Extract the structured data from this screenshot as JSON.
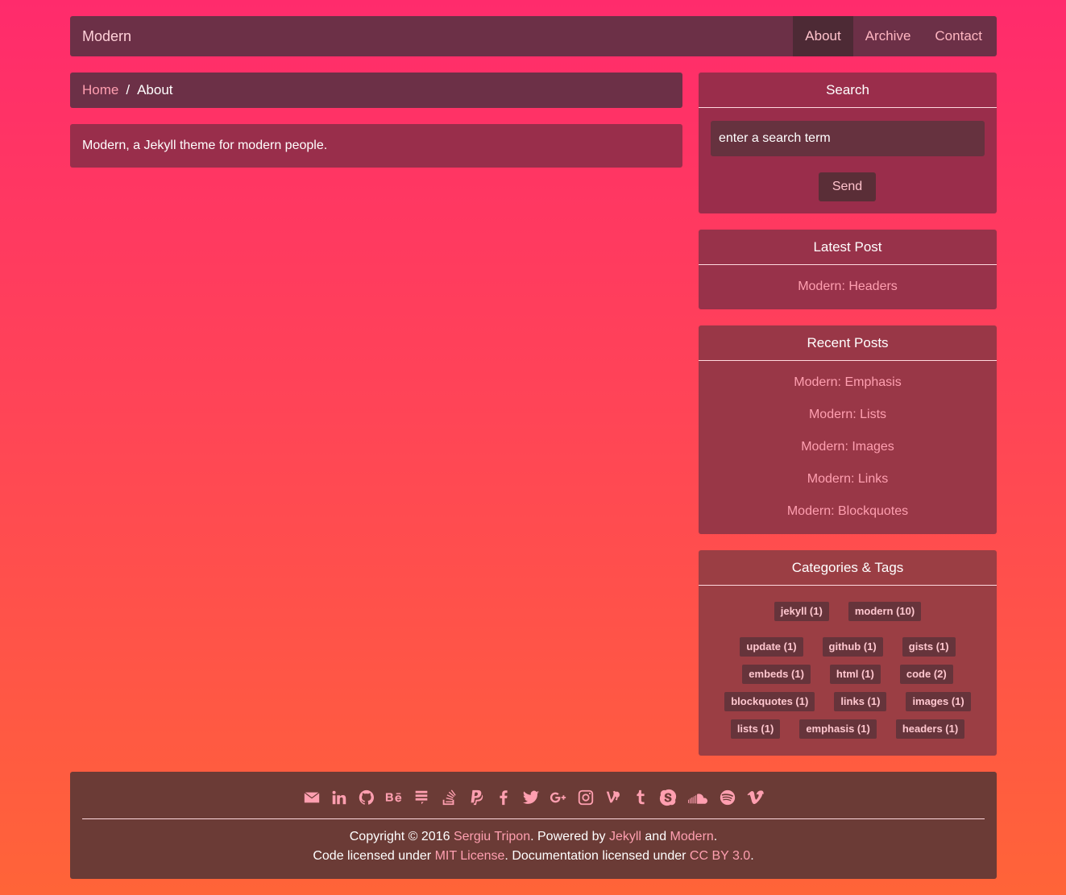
{
  "nav": {
    "brand": "Modern",
    "items": [
      {
        "label": "About",
        "active": true
      },
      {
        "label": "Archive"
      },
      {
        "label": "Contact"
      }
    ]
  },
  "breadcrumb": {
    "home": "Home",
    "separator": "/",
    "current": "About"
  },
  "content": {
    "text": "Modern, a Jekyll theme for modern people."
  },
  "search": {
    "title": "Search",
    "placeholder": "enter a search term",
    "button": "Send"
  },
  "latest": {
    "title": "Latest Post",
    "post": "Modern: Headers"
  },
  "recent": {
    "title": "Recent Posts",
    "posts": [
      "Modern: Emphasis",
      "Modern: Lists",
      "Modern: Images",
      "Modern: Links",
      "Modern: Blockquotes"
    ]
  },
  "tags": {
    "title": "Categories & Tags",
    "categories": [
      "jekyll (1)",
      "modern (10)"
    ],
    "tag_rows": [
      [
        "update (1)",
        "github (1)",
        "gists (1)"
      ],
      [
        "embeds (1)",
        "html (1)",
        "code (2)"
      ],
      [
        "blockquotes (1)",
        "links (1)",
        "images (1)"
      ],
      [
        "lists (1)",
        "emphasis (1)",
        "headers (1)"
      ]
    ]
  },
  "footer": {
    "social_icons": [
      "envelope-icon",
      "linkedin-icon",
      "github-icon",
      "behance-icon",
      "stack-exchange-icon",
      "stack-overflow-icon",
      "paypal-icon",
      "facebook-icon",
      "twitter-icon",
      "google-plus-icon",
      "instagram-icon",
      "vine-icon",
      "tumblr-icon",
      "skype-icon",
      "soundcloud-icon",
      "spotify-icon",
      "vimeo-icon"
    ],
    "line1_prefix": "Copyright © 2016 ",
    "author": "Sergiu Tripon",
    "line1_mid": ". Powered by ",
    "jekyll": "Jekyll",
    "and": " and ",
    "modern": "Modern",
    "line1_end": ".",
    "line2_prefix": "Code licensed under ",
    "mit": "MIT License",
    "line2_mid": ". Documentation licensed under ",
    "cc": "CC BY 3.0",
    "line2_end": "."
  }
}
